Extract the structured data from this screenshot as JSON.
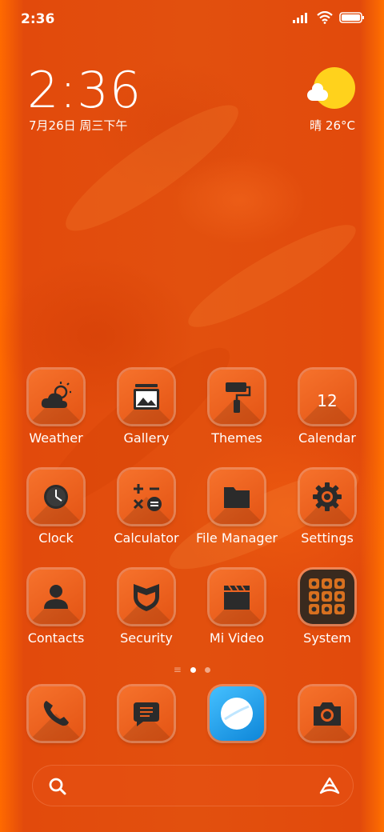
{
  "status_bar": {
    "time": "2:36"
  },
  "clock_widget": {
    "time": "2:36",
    "date": "7月26日 周三下午"
  },
  "weather_widget": {
    "condition_temp": "晴 26°C",
    "icon": "sunny-cloud-icon"
  },
  "apps": [
    {
      "label": "Weather",
      "icon": "weather-icon"
    },
    {
      "label": "Gallery",
      "icon": "gallery-icon"
    },
    {
      "label": "Themes",
      "icon": "themes-icon"
    },
    {
      "label": "Calendar",
      "icon": "calendar-icon",
      "day": "12"
    },
    {
      "label": "Clock",
      "icon": "clock-icon"
    },
    {
      "label": "Calculator",
      "icon": "calculator-icon"
    },
    {
      "label": "File Manager",
      "icon": "folder-icon"
    },
    {
      "label": "Settings",
      "icon": "gear-icon"
    },
    {
      "label": "Contacts",
      "icon": "contacts-icon"
    },
    {
      "label": "Security",
      "icon": "shield-icon"
    },
    {
      "label": "Mi Video",
      "icon": "clapperboard-icon"
    },
    {
      "label": "System",
      "icon": "system-folder-icon"
    }
  ],
  "dock": [
    {
      "icon": "phone-icon"
    },
    {
      "icon": "messages-icon"
    },
    {
      "icon": "browser-icon"
    },
    {
      "icon": "camera-icon"
    }
  ],
  "page_indicator": {
    "pages": 2,
    "current": 1
  },
  "colors": {
    "accent": "#e45414",
    "sun": "#ffd21c",
    "browser": "#1ea0f0"
  }
}
